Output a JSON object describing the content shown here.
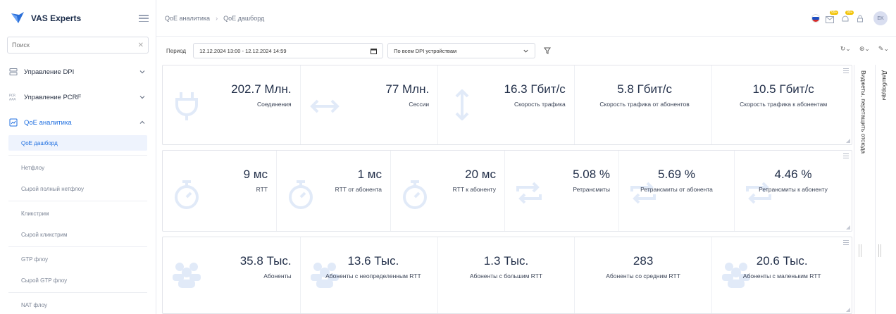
{
  "app": {
    "name": "VAS Experts",
    "brand_color": "#1f6fe0"
  },
  "search": {
    "placeholder": "Поиск"
  },
  "sidebar": {
    "groups": [
      {
        "label": "Управление DPI",
        "icon": "server-icon",
        "expanded": false
      },
      {
        "label": "Управление PCRF",
        "icon": "pcrf-icon",
        "expanded": false
      },
      {
        "label": "QoE аналитика",
        "icon": "chart-icon",
        "expanded": true
      }
    ],
    "sub_items": [
      {
        "label": "QoE дашборд",
        "active": true
      },
      {
        "label": "Нетфлоу"
      },
      {
        "label": "Сырой полный нетфлоу"
      },
      {
        "label": "Кликстрим"
      },
      {
        "label": "Сырой кликстрим"
      },
      {
        "label": "GTP флоу"
      },
      {
        "label": "Сырой GTP флоу"
      },
      {
        "label": "NAT флоу"
      }
    ]
  },
  "breadcrumb": [
    "QoE аналитика",
    "QoE дашборд"
  ],
  "header": {
    "avatar_initials": "EK",
    "badge_count": "99+"
  },
  "filters": {
    "period_label": "Период",
    "period_value": "12.12.2024 13:00 - 12.12.2024 14:59",
    "dpi_value": "По всем DPI устройствам"
  },
  "panels": [
    {
      "tiles": [
        {
          "value": "202.7 Млн.",
          "label": "Соединения",
          "icon": "plug-icon"
        },
        {
          "value": "77 Млн.",
          "label": "Сессии",
          "icon": "arrows-horizontal-icon"
        },
        {
          "value": "16.3 Гбит/с",
          "label": "Скорость трафика",
          "icon": "arrows-vertical-icon"
        },
        {
          "value": "5.8 Гбит/с",
          "label": "Скорость трафика от абонентов",
          "icon": "none"
        },
        {
          "value": "10.5 Гбит/с",
          "label": "Скорость трафика к абонентам",
          "icon": "none"
        }
      ]
    },
    {
      "tiles": [
        {
          "value": "9 мс",
          "label": "RTT",
          "icon": "stopwatch-icon"
        },
        {
          "value": "1 мс",
          "label": "RTT от абонента",
          "icon": "stopwatch-icon"
        },
        {
          "value": "20 мс",
          "label": "RTT к абоненту",
          "icon": "stopwatch-icon"
        },
        {
          "value": "5.08 %",
          "label": "Ретрансмиты",
          "icon": "repeat-icon"
        },
        {
          "value": "5.69 %",
          "label": "Ретрансмиты от абонента",
          "icon": "repeat-icon"
        },
        {
          "value": "4.46 %",
          "label": "Ретрансмиты к абоненту",
          "icon": "repeat-icon"
        }
      ]
    },
    {
      "tiles": [
        {
          "value": "35.8 Тыс.",
          "label": "Абоненты",
          "icon": "users-icon"
        },
        {
          "value": "13.6 Тыс.",
          "label": "Абоненты с неопределенным RTT",
          "icon": "users-icon"
        },
        {
          "value": "1.3 Тыс.",
          "label": "Абоненты с большим RTT",
          "icon": "none"
        },
        {
          "value": "283",
          "label": "Абоненты со средним RTT",
          "icon": "none"
        },
        {
          "value": "20.6 Тыс.",
          "label": "Абоненты с маленьким RTT",
          "icon": "users-icon"
        }
      ]
    }
  ],
  "rails": {
    "widgets": "Виджеты, перетащить отсюда",
    "dashboards": "Дашборды"
  }
}
